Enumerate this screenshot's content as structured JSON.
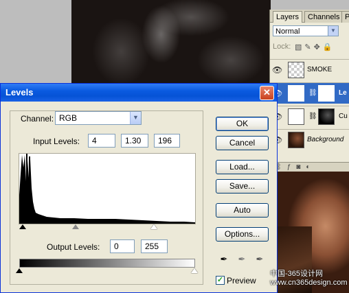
{
  "layers_panel": {
    "tabs": [
      {
        "label": "Layers",
        "active": true
      },
      {
        "label": "Channels",
        "active": false
      },
      {
        "label": "P",
        "active": false
      }
    ],
    "blend_mode": "Normal",
    "lock_label": "Lock:",
    "layers": [
      {
        "name": "SMOKE",
        "selected": false,
        "visible": true
      },
      {
        "name": "Le",
        "selected": true,
        "visible": true
      },
      {
        "name": "Cu",
        "selected": false,
        "visible": true
      },
      {
        "name": "Background",
        "selected": false,
        "visible": true
      }
    ]
  },
  "dialog": {
    "title": "Levels",
    "channel_label": "Channel:",
    "channel_value": "RGB",
    "input_levels_label": "Input Levels:",
    "input_levels": {
      "black": "4",
      "gamma": "1.30",
      "white": "196"
    },
    "output_levels_label": "Output Levels:",
    "output_levels": {
      "black": "0",
      "white": "255"
    },
    "buttons": {
      "ok": "OK",
      "cancel": "Cancel",
      "load": "Load...",
      "save": "Save...",
      "auto": "Auto",
      "options": "Options..."
    },
    "preview_label": "Preview",
    "preview_checked": true
  },
  "watermark": {
    "line1": "中国-365设计网",
    "line2": "www.cn365design.com"
  }
}
